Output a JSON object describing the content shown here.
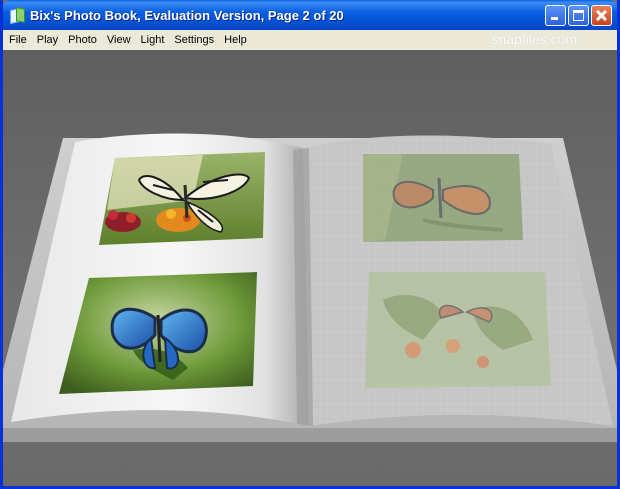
{
  "window": {
    "title": "Bix's Photo Book, Evaluation Version, Page 2 of 20",
    "app_icon": "photo-book-icon",
    "buttons": {
      "minimize_icon": "minimize-icon",
      "maximize_icon": "maximize-icon",
      "close_icon": "close-icon"
    }
  },
  "menu": {
    "items": [
      {
        "label": "File"
      },
      {
        "label": "Play"
      },
      {
        "label": "Photo"
      },
      {
        "label": "View"
      },
      {
        "label": "Light"
      },
      {
        "label": "Settings"
      },
      {
        "label": "Help"
      }
    ]
  },
  "watermark": "snapfiles.com",
  "book": {
    "current_page": 2,
    "total_pages": 20,
    "left_page": {
      "photos": [
        {
          "subject": "butterfly-on-flowers-photo"
        },
        {
          "subject": "blue-morpho-butterfly-photo"
        }
      ]
    },
    "right_page": {
      "faded": true,
      "photos": [
        {
          "subject": "orange-butterfly-on-leaf-photo"
        },
        {
          "subject": "butterfly-on-orange-flowers-photo"
        }
      ]
    }
  },
  "colors": {
    "title_bar": "#0553d6",
    "menu_bg": "#ece9d8",
    "viewport_bg": "#6e6e6e",
    "page_left": "#f4f4f4",
    "page_right": "#c9c9c9"
  }
}
